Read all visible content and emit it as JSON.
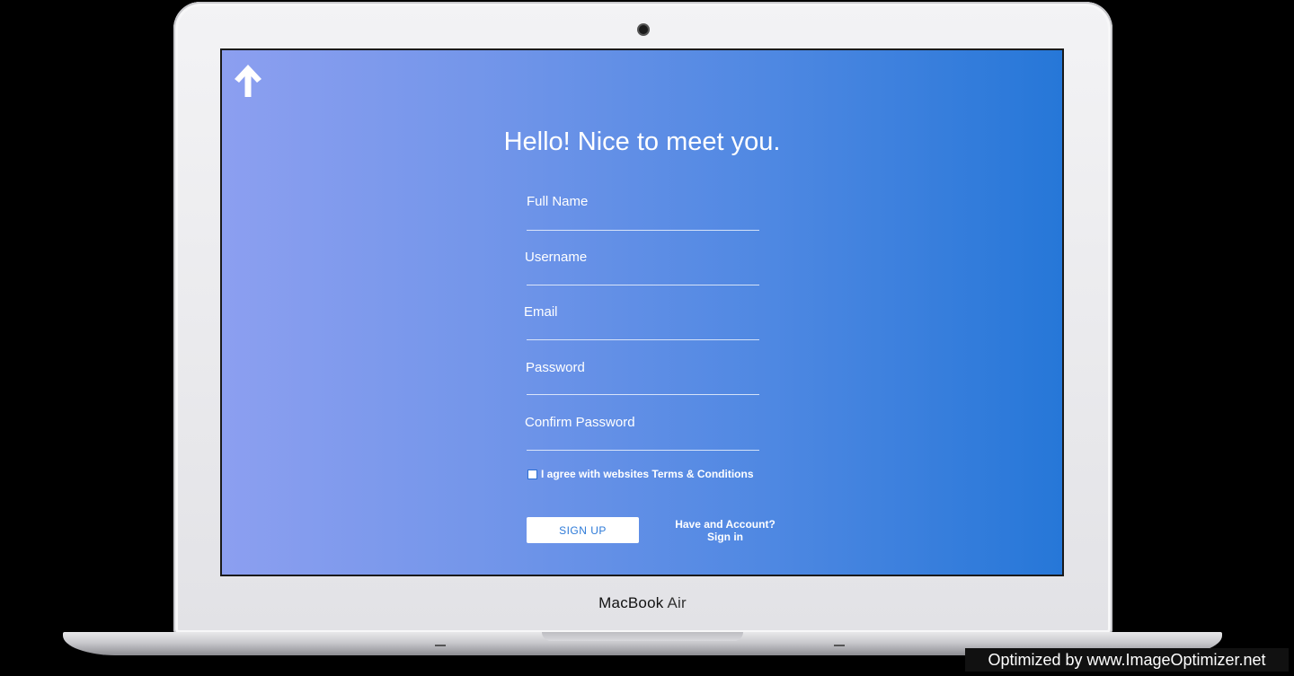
{
  "form": {
    "title": "Hello! Nice to meet you.",
    "fields": [
      {
        "label": "Full Name"
      },
      {
        "label": "Username"
      },
      {
        "label": "Email"
      },
      {
        "label": "Password"
      },
      {
        "label": "Confirm Password"
      }
    ],
    "terms_label": "I agree with websites Terms & Conditions",
    "terms_checked": false,
    "signup_label": "SIGN UP",
    "account_line1": "Have and Account?",
    "account_line2": "Sign in"
  },
  "device": {
    "brand_bold": "MacBook",
    "brand_light": "Air"
  },
  "watermark": "Optimized by www.ImageOptimizer.net",
  "icons": {
    "back": "up-arrow-icon"
  },
  "colors": {
    "gradient_start": "#8c9ff0",
    "gradient_end": "#2677d8",
    "button_text": "#2d7ad8"
  }
}
